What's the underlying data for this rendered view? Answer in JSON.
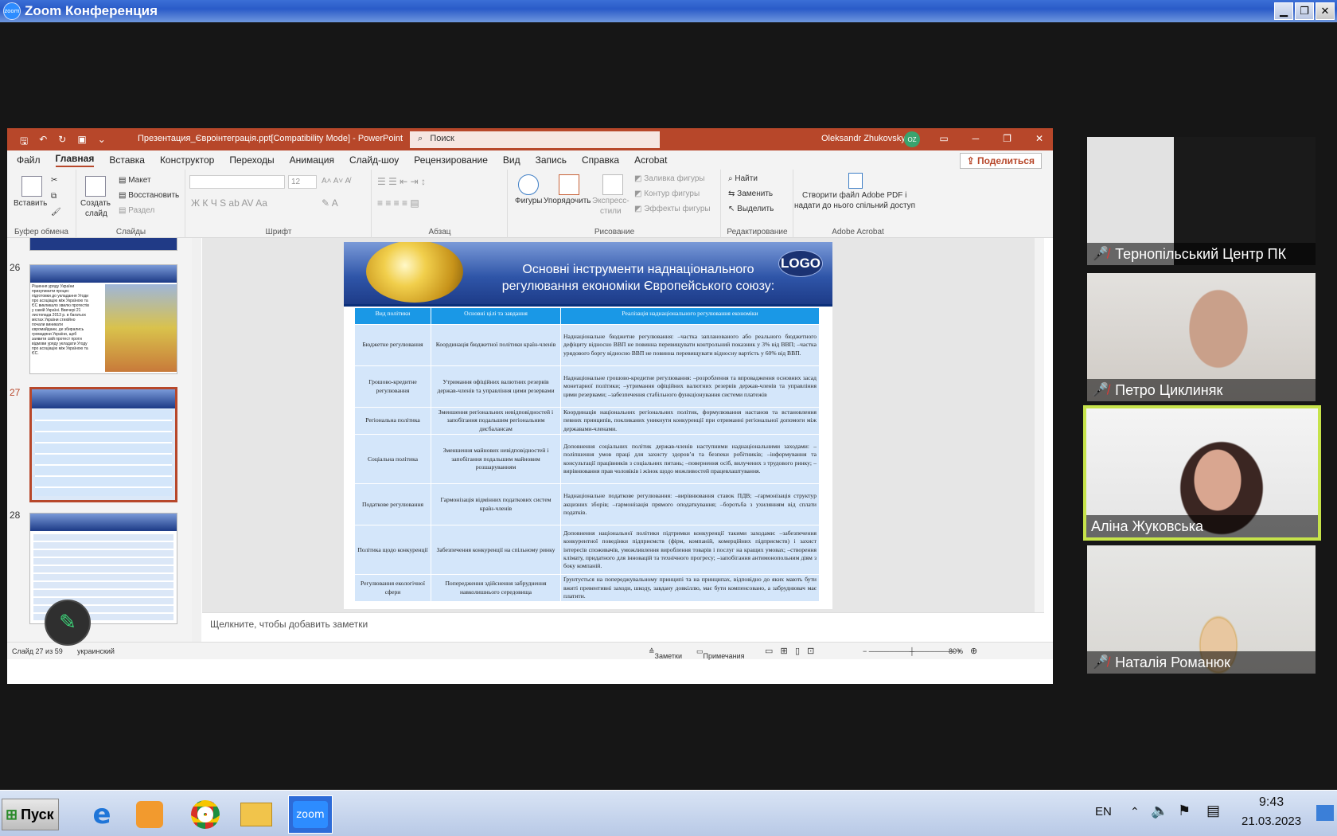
{
  "zoom": {
    "title": "Zoom Конференция",
    "logo_text": "zoom"
  },
  "ppt": {
    "doc_title": "Презентация_Євроінтеграція.ppt[Compatibility Mode]  -  PowerPoint",
    "search_placeholder": "Поиск",
    "user": "Oleksandr Zhukovsky",
    "user_initials": "OZ",
    "menu": [
      "Файл",
      "Главная",
      "Вставка",
      "Конструктор",
      "Переходы",
      "Анимация",
      "Слайд-шоу",
      "Рецензирование",
      "Вид",
      "Запись",
      "Справка",
      "Acrobat"
    ],
    "share": "Поделиться",
    "ribbon": {
      "paste": "Вставить",
      "new_slide_1": "Создать",
      "new_slide_2": "слайд",
      "layout": "Макет",
      "reset": "Восстановить",
      "section": "Раздел",
      "font_size": "12",
      "shapes": "Фигуры",
      "arrange": "Упорядочить",
      "quick_styles_1": "Экспресс-",
      "quick_styles_2": "стили",
      "fill": "Заливка фигуры",
      "outline": "Контур фигуры",
      "effects": "Эффекты фигуры",
      "find": "Найти",
      "replace": "Заменить",
      "select": "Выделить",
      "acrobat_1": "Створити файл Adobe PDF і",
      "acrobat_2": "надати до нього спільний доступ",
      "groups": [
        "Буфер обмена",
        "Слайды",
        "Шрифт",
        "Абзац",
        "Рисование",
        "Редактирование",
        "Adobe Acrobat"
      ]
    },
    "thumbs": {
      "n26": "26",
      "n27": "27",
      "n28": "28",
      "t26_text": "Рішення уряду України призупинити процес підготовки до укладання Угоди про асоціацію між Україною та ЄС викликало хвилю протестів у самій Україні. Ввечері 21 листопада 2013 р. в багатьох містах України стихійно почали виникати євромайдани, де збирались громадяни України, щоб заявити свій протест проти відмови уряду укладати Угоду про асоціацію між Україною та ЄС."
    },
    "slide": {
      "logo": "LOGO",
      "title_1": "Основні інструменти наднаціонального",
      "title_2": "регулювання економіки Європейського союзу:",
      "headers": [
        "Вид політики",
        "Основні цілі та завдання",
        "Реалізація наднаціонального регулювання економіки"
      ],
      "rows": [
        {
          "kind": "Бюджетне регулювання",
          "goal": "Координація бюджетної політики країн-членів",
          "impl": "Наднаціональне бюджетне регулювання: –частка запланованого або реального бюджетного дефіциту відносно ВВП не повинна перевищувати контрольний показник у 3% від ВВП; –частка урядового боргу відносно ВВП не повинна перевищувати відносну вартість у 60% від ВВП."
        },
        {
          "kind": "Грошово-кредитне регулювання",
          "goal": "Утримання офіційних валютних резервів держав-членів та управління цими резервами",
          "impl": "Наднаціональне грошово-кредитне регулювання: –розроблення та впровадження основних засад монетарної політики; –утримання офіційних валютних резервів держав-членів та управління цими резервами; –забезпечення стабільного функціонування системи платежів"
        },
        {
          "kind": "Регіональна політика",
          "goal": "Зменшення регіональних невідповідностей і запобігання подальшим регіональним дисбалансам",
          "impl": "Координація національних регіональних політик, формулювання настанов та встановлення певних принципів, покликаних уникнути конкуренції при отриманні регіональної допомоги між державами-членами."
        },
        {
          "kind": "Соціальна політика",
          "goal": "Зменшення майнових невідповідностей і запобігання подальшим майновим розшаруванням",
          "impl": "Доповнення соціальних політик держав-членів наступними наднаціональними заходами: –поліпшення умов праці для захисту здоров’я та безпеки робітників; –інформування та консультації працівників з соціальних питань; –повернення осіб, вилучених з трудового ринку; –вирівнювання прав чоловіків і жінок щодо можливостей працевлаштування."
        },
        {
          "kind": "Податкове регулювання",
          "goal": "Гармонізація відмінних податкових систем країн-членів",
          "impl": "Наднаціональне податкове регулювання: –вирівнювання ставок ПДВ; –гармонізація структур акцизних зборів; –гармонізація прямого оподаткування; –боротьба з ухилянням від сплати податків."
        },
        {
          "kind": "Політика щодо конкуренції",
          "goal": "Забезпечення конкуренції на спільному ринку",
          "impl": "Доповнення національної політики підтримки конкуренції такими заходами: –забезпечення конкурентної поведінки підприємств (фірм, компаній, комерційних підприємств) і захист інтересів споживачів, умож­ливлення вироблення товарів і послуг на кращих умовах; –створення клімату, придатного для інновацій та технічного прогресу; –запобігання антимонопольним діям з боку компаній."
        },
        {
          "kind": "Регулювання екологічної сфери",
          "goal": "Попередження здійснення забруднення навколишнього середовища",
          "impl": "Ґрунтується на попереджувальному принципі та на принципах, відповідно до яких мають бути вжиті превентивні заходи, шкоду, завдану довкіллю, має бути компенсовано, а забруднювач має платити."
        }
      ]
    },
    "notes": "Щелкните, чтобы добавить заметки",
    "status": {
      "slide": "Слайд 27 из 59",
      "lang": "украинский",
      "notes": "Заметки",
      "comments": "Примечания",
      "zoom": "80%"
    }
  },
  "participants": [
    {
      "name": "Тернопільський Центр ПК",
      "muted": true
    },
    {
      "name": "Петро Циклиняк",
      "muted": true
    },
    {
      "name": "Аліна Жуковська",
      "muted": false
    },
    {
      "name": "Наталія Романюк",
      "muted": true
    }
  ],
  "taskbar": {
    "start": "Пуск",
    "lang": "EN",
    "time": "9:43",
    "date": "21.03.2023",
    "zoom_label": "zoom"
  }
}
